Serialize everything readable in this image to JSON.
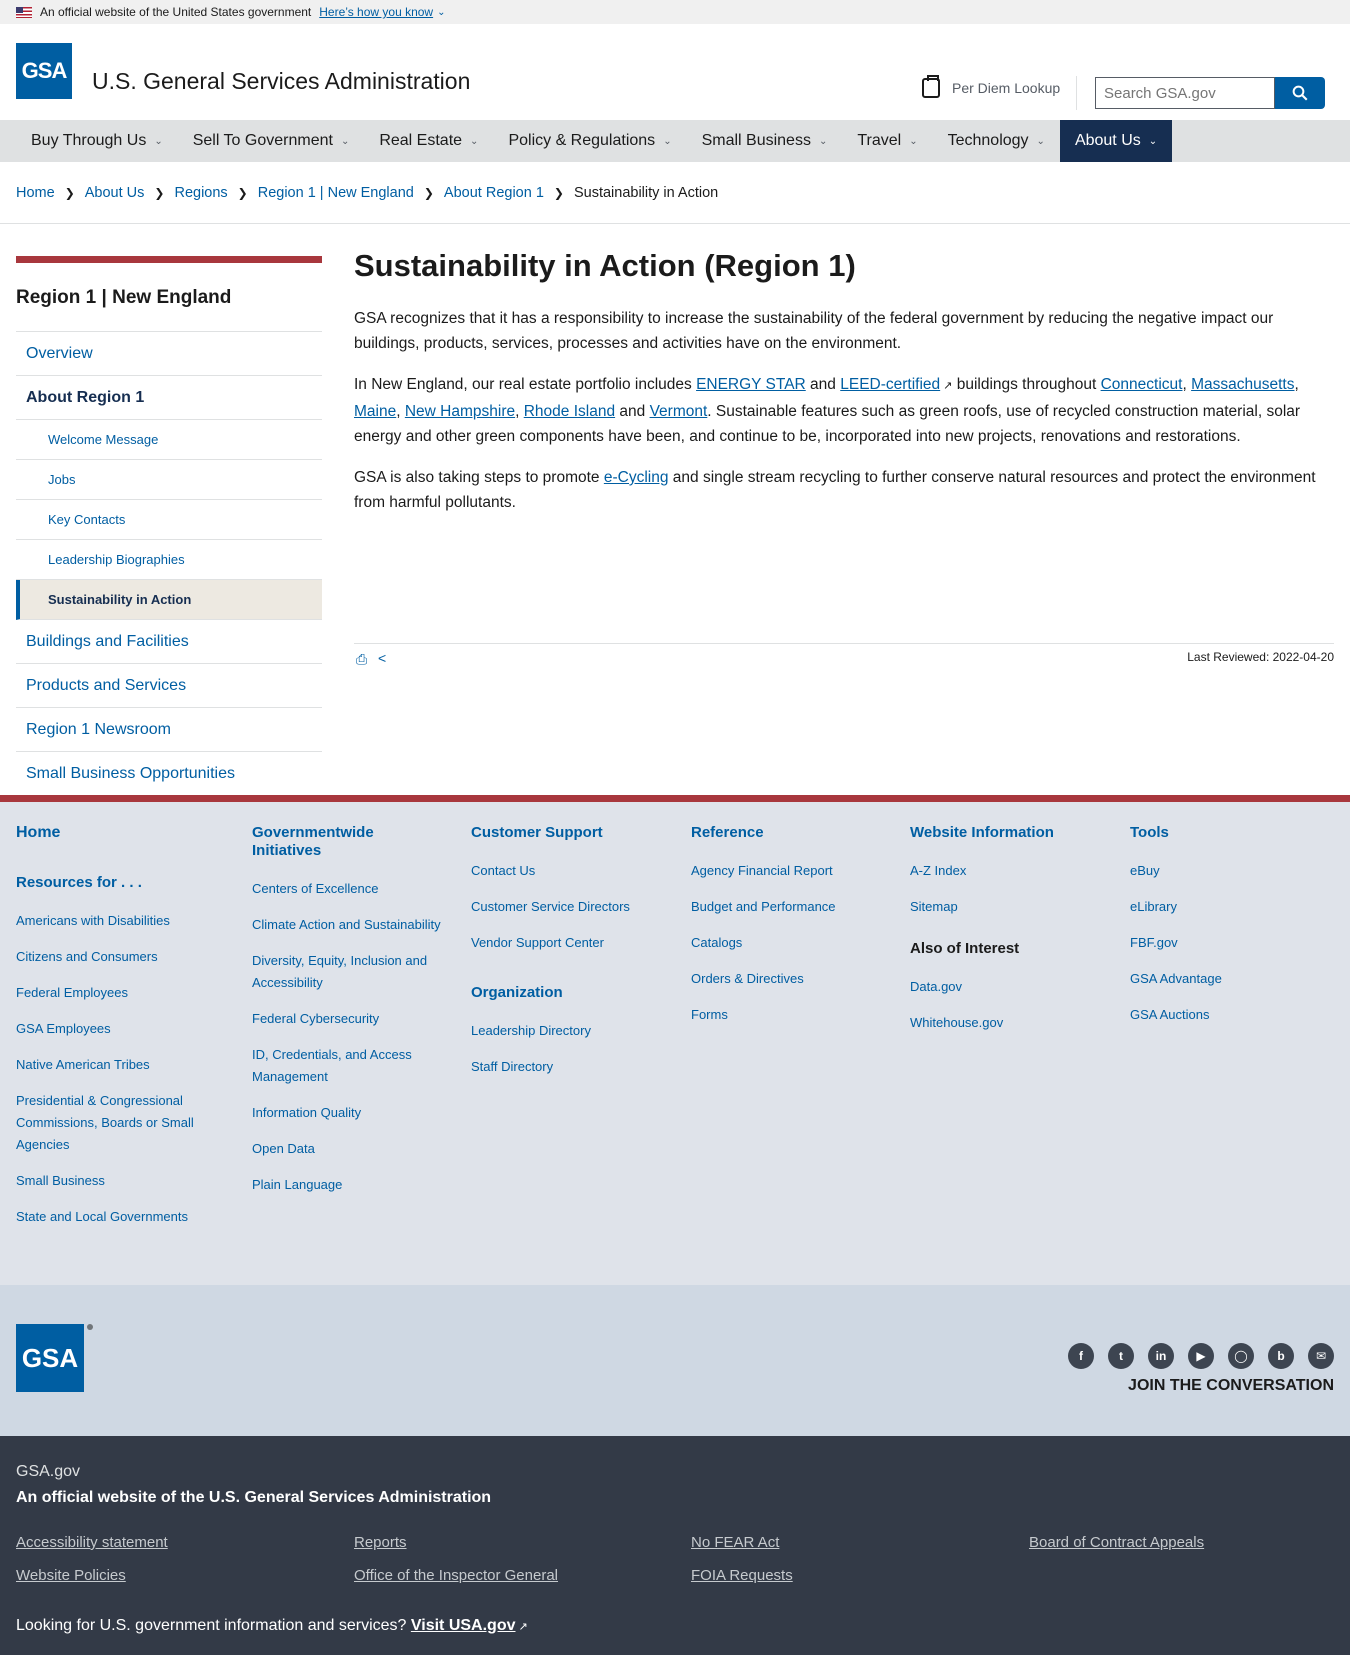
{
  "banner": {
    "text": "An official website of the United States government",
    "link": "Here’s how you know"
  },
  "header": {
    "logo_text": "GSA",
    "site_title": "U.S. General Services Administration",
    "per_diem": "Per Diem Lookup",
    "search_placeholder": "Search GSA.gov"
  },
  "nav": [
    "Buy Through Us",
    "Sell To Government",
    "Real Estate",
    "Policy & Regulations",
    "Small Business",
    "Travel",
    "Technology",
    "About Us"
  ],
  "breadcrumb": [
    "Home",
    "About Us",
    "Regions",
    "Region 1 | New England",
    "About Region 1",
    "Sustainability in Action"
  ],
  "sidenav": {
    "title": "Region 1 | New England",
    "items": [
      "Overview",
      "About Region 1",
      "Welcome Message",
      "Jobs",
      "Key Contacts",
      "Leadership Biographies",
      "Sustainability in Action",
      "Buildings and Facilities",
      "Products and Services",
      "Region 1 Newsroom",
      "Small Business Opportunities"
    ]
  },
  "content": {
    "title": "Sustainability in Action (Region 1)",
    "p1": "GSA recognizes that it has a responsibility to increase the sustainability of the federal government by reducing the negative impact our buildings, products, services, processes and activities have on the environment.",
    "p2": {
      "t1": "In New England, our real estate portfolio includes ",
      "l1": "ENERGY STAR",
      "t2": " and ",
      "l2": "LEED-certified",
      "t3": " buildings throughout ",
      "l3": "Connecticut",
      "l4": "Massachusetts",
      "l5": "Maine",
      "l6": "New Hampshire",
      "l7": "Rhode Island",
      "t4": " and ",
      "l8": "Vermont",
      "t5": ". Sustainable features such as green roofs, use of recycled construction material, solar energy and other green components have been, and continue to be, incorporated into new projects, renovations and restorations."
    },
    "p3": {
      "t1": "GSA is also taking steps to promote ",
      "l1": "e-Cycling",
      "t2": " and single stream recycling to further conserve natural resources and protect the environment from harmful pollutants."
    },
    "last_reviewed": "Last Reviewed: 2022-04-20"
  },
  "footer": {
    "home": "Home",
    "resources_title": "Resources for . . .",
    "resources": [
      "Americans with Disabilities",
      "Citizens and Consumers",
      "Federal Employees",
      "GSA Employees",
      "Native American Tribes",
      "Presidential & Congressional Commissions, Boards or Small Agencies",
      "Small Business",
      "State and Local Governments"
    ],
    "initiatives_title": "Governmentwide Initiatives",
    "initiatives": [
      "Centers of Excellence",
      "Climate Action and Sustainability",
      "Diversity, Equity, Inclusion and Accessibility",
      "Federal Cybersecurity",
      "ID, Credentials, and Access Management",
      "Information Quality",
      "Open Data",
      "Plain Language"
    ],
    "support_title": "Customer Support",
    "support": [
      "Contact Us",
      "Customer Service Directors",
      "Vendor Support Center"
    ],
    "org_title": "Organization",
    "org": [
      "Leadership Directory",
      "Staff Directory"
    ],
    "reference_title": "Reference",
    "reference": [
      "Agency Financial Report",
      "Budget and Performance",
      "Catalogs",
      "Orders & Directives",
      "Forms"
    ],
    "webinfo_title": "Website Information",
    "webinfo": [
      "A-Z Index",
      "Sitemap"
    ],
    "interest_title": "Also of Interest",
    "interest": [
      "Data.gov",
      "Whitehouse.gov"
    ],
    "tools_title": "Tools",
    "tools": [
      "eBuy",
      "eLibrary",
      "FBF.gov",
      "GSA Advantage",
      "GSA Auctions"
    ],
    "join": "JOIN THE CONVERSATION",
    "site": "GSA.gov",
    "official": "An official website of the U.S. General Services Administration",
    "bottom_links": [
      "Accessibility statement",
      "Reports",
      "No FEAR Act",
      "Board of Contract Appeals",
      "Website Policies",
      "Office of the Inspector General",
      "FOIA Requests"
    ],
    "usa_text": "Looking for U.S. government information and services?",
    "usa_link": "Visit USA.gov"
  }
}
